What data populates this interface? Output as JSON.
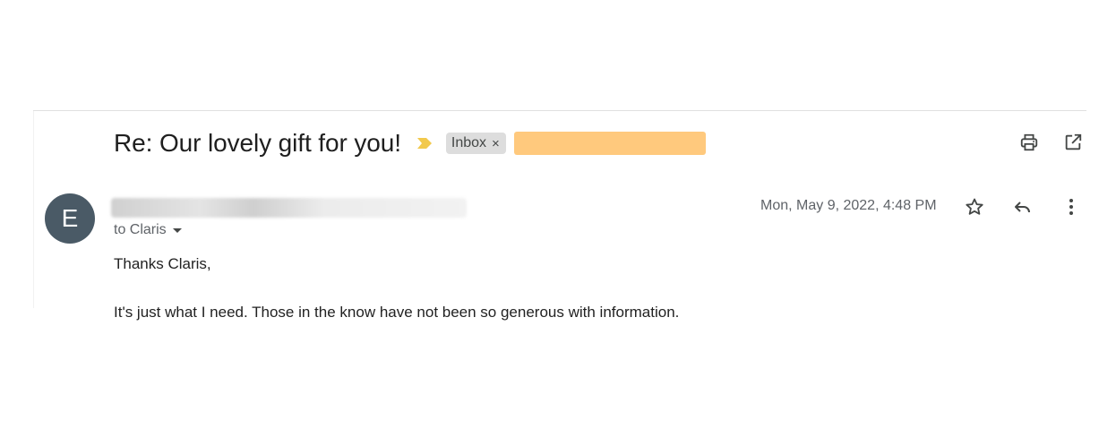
{
  "thread": {
    "subject": "Re: Our lovely gift for you!",
    "labels": [
      {
        "name": "Inbox",
        "remove_glyph": "×"
      }
    ]
  },
  "message": {
    "avatar_initial": "E",
    "recipient_prefix": "to Claris",
    "date": "Mon, May 9, 2022, 4:48 PM",
    "body": {
      "greeting": "Thanks Claris,",
      "line1": "It's just what I need. Those in the know have not been so generous with information."
    }
  },
  "icons": {
    "importance": "importance-marker-icon",
    "print": "print-icon",
    "open_new_window": "open-in-new-window-icon",
    "star": "star-icon",
    "reply": "reply-icon",
    "more": "more-vert-icon",
    "caret": "caret-down-icon"
  },
  "colors": {
    "importance_marker": "#f2c94c",
    "avatar_bg": "#4a5a66",
    "label_chip_bg": "#dddddd",
    "redacted_label": "#ffc97d"
  }
}
